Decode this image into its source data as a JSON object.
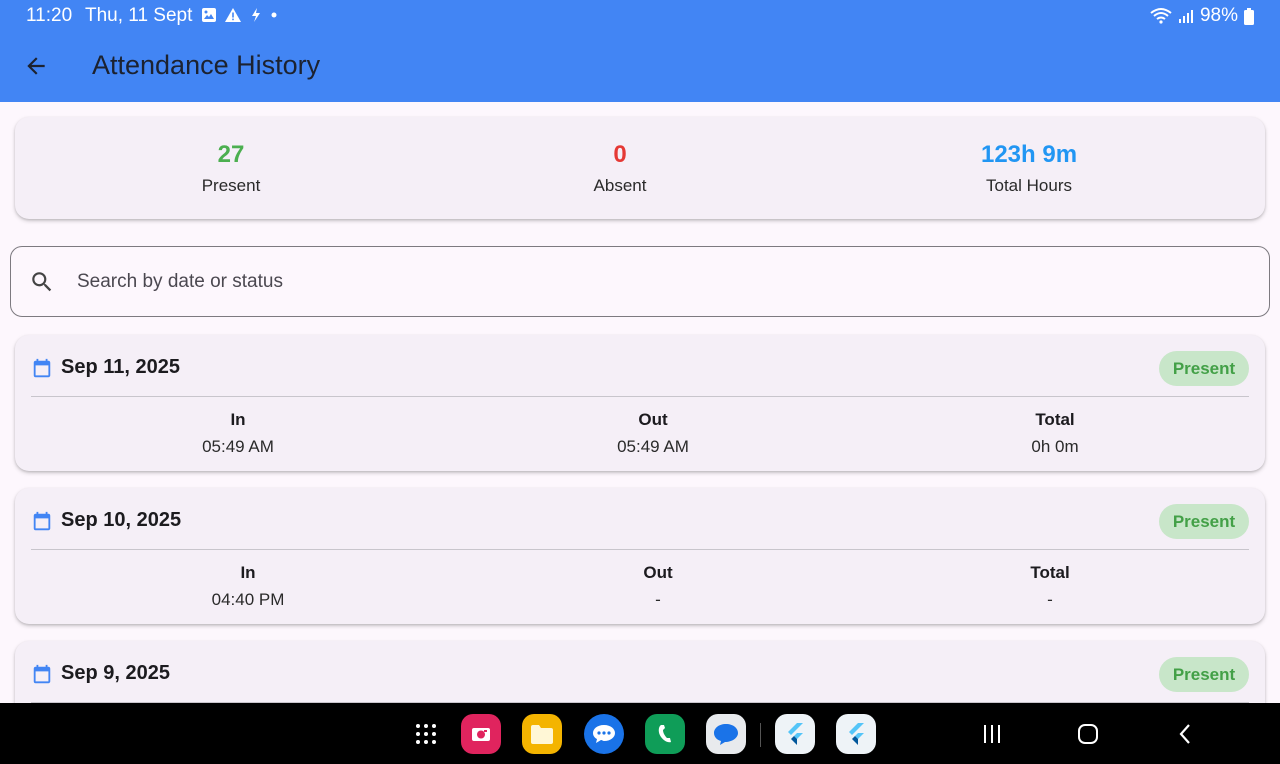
{
  "status_bar": {
    "time": "11:20",
    "date": "Thu, 11 Sept",
    "battery": "98%"
  },
  "app_bar": {
    "title": "Attendance History"
  },
  "summary": {
    "present": {
      "value": "27",
      "label": "Present",
      "color": "#4caf50"
    },
    "absent": {
      "value": "0",
      "label": "Absent",
      "color": "#e53935"
    },
    "total": {
      "value": "123h 9m",
      "label": "Total Hours",
      "color": "#2196f3"
    }
  },
  "search": {
    "placeholder": "Search by date or status",
    "value": ""
  },
  "records": [
    {
      "date": "Sep 11, 2025",
      "status": "Present",
      "in_label": "In",
      "in": "05:49 AM",
      "out_label": "Out",
      "out": "05:49 AM",
      "total_label": "Total",
      "total": "0h 0m"
    },
    {
      "date": "Sep 10, 2025",
      "status": "Present",
      "in_label": "In",
      "in": "04:40 PM",
      "out_label": "Out",
      "out": "-",
      "total_label": "Total",
      "total": "-"
    },
    {
      "date": "Sep 9, 2025",
      "status": "Present"
    }
  ],
  "dock": [
    "apps-grid-icon",
    "camera-app-icon",
    "files-app-icon",
    "messages-app-icon",
    "phone-app-icon",
    "chat-app-icon",
    "flutter-app-icon",
    "flutter-app-icon"
  ],
  "colors": {
    "app_bar": "#4285f4",
    "present_badge_bg": "#c8e6c9",
    "present_badge_text": "#43a047"
  }
}
